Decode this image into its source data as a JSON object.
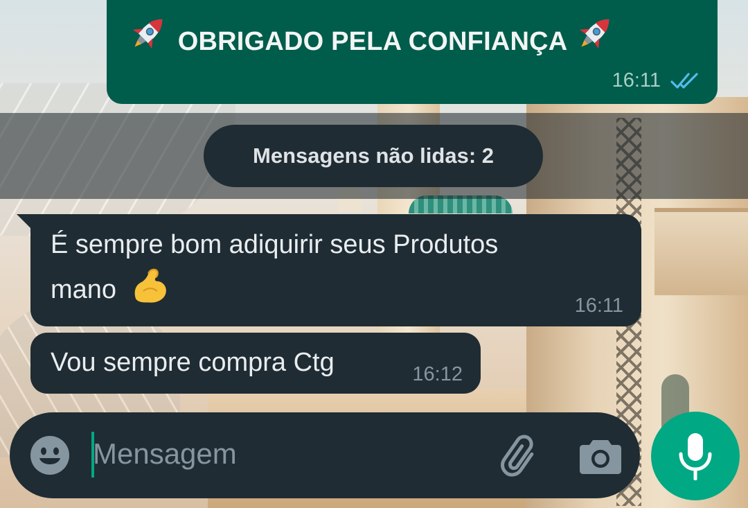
{
  "messages": [
    {
      "direction": "outgoing",
      "text": "OBRIGADO PELA CONFIANÇA",
      "emoji_before": "rocket-emoji",
      "emoji_after": "rocket-emoji",
      "time": "16:11",
      "status": "read"
    },
    {
      "direction": "incoming",
      "text_line1": "É sempre bom adiquirir seus Produtos",
      "text_line2": "mano",
      "emoji_after": "flexed-biceps-emoji",
      "time": "16:11"
    },
    {
      "direction": "incoming",
      "text": "Vou sempre compra Ctg",
      "time": "16:12"
    }
  ],
  "unread_banner": {
    "text": "Mensagens não lidas: 2"
  },
  "composer": {
    "placeholder": "Mensagem",
    "value": "",
    "icons": [
      "emoji-icon",
      "attach-icon",
      "camera-icon",
      "mic-icon"
    ]
  },
  "colors": {
    "outgoing_bubble": "#005c4b",
    "incoming_bubble": "#1f2c34",
    "accent": "#00a884",
    "read_ticks": "#53bdeb",
    "meta_text": "#8696a0"
  }
}
